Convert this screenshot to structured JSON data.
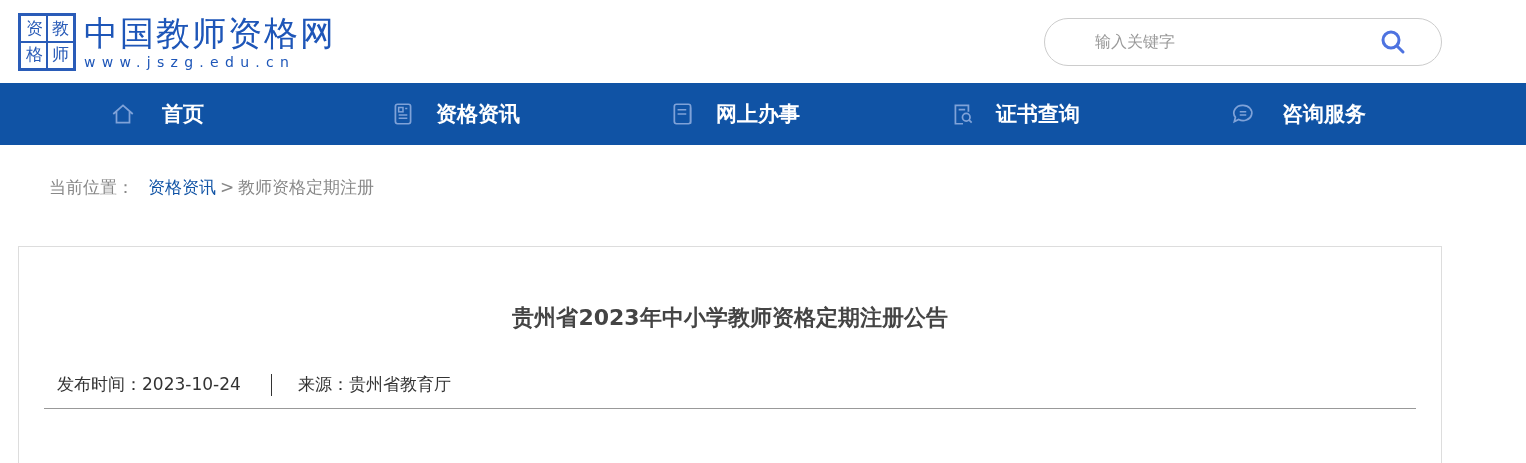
{
  "header": {
    "logo_mark": [
      "资",
      "教",
      "格",
      "师"
    ],
    "site_name": "中国教师资格网",
    "site_url": "www.jszg.edu.cn",
    "search": {
      "placeholder": "输入关键字"
    }
  },
  "nav": [
    {
      "kind": "home",
      "label": "首页"
    },
    {
      "kind": "news",
      "label": "资格资讯"
    },
    {
      "kind": "doc",
      "label": "网上办事"
    },
    {
      "kind": "query",
      "label": "证书查询"
    },
    {
      "kind": "chat",
      "label": "咨询服务"
    }
  ],
  "breadcrumb": {
    "prefix": "当前位置：",
    "link": "资格资讯",
    "separator": ">",
    "current": "教师资格定期注册"
  },
  "article": {
    "title": "贵州省2023年中小学教师资格定期注册公告",
    "published": "发布时间：2023-10-24",
    "source": "来源：贵州省教育厅"
  }
}
